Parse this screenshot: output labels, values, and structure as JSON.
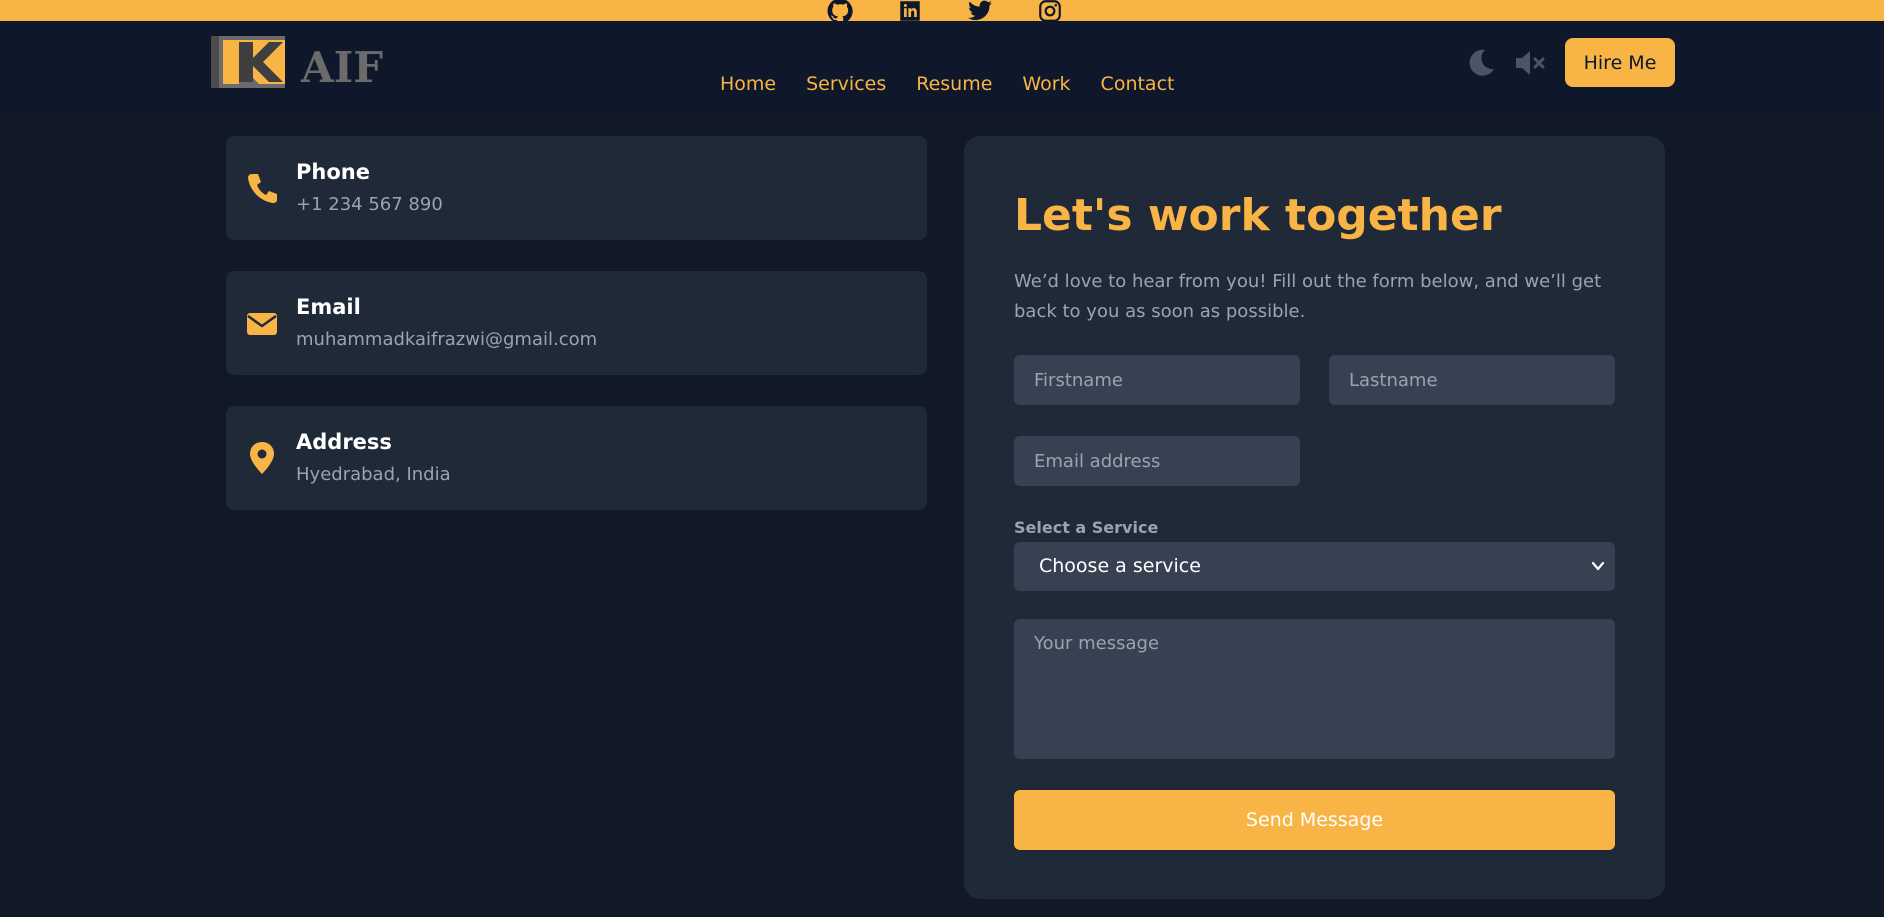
{
  "brand": {
    "logo_text": "AIF",
    "accent_color": "#f8b445",
    "background_color": "#111827"
  },
  "social_links": [
    {
      "icon": "github-icon"
    },
    {
      "icon": "linkedin-icon"
    },
    {
      "icon": "twitter-icon"
    },
    {
      "icon": "instagram-icon"
    }
  ],
  "nav": {
    "items": [
      "Home",
      "Services",
      "Resume",
      "Work",
      "Contact"
    ],
    "theme_toggle_icon": "moon-icon",
    "sound_toggle_icon": "volume-mute-icon",
    "hire_label": "Hire Me"
  },
  "contact_info": [
    {
      "icon": "phone-icon",
      "title": "Phone",
      "value": "+1 234 567 890"
    },
    {
      "icon": "envelope-icon",
      "title": "Email",
      "value": "muhammadkaifrazwi@gmail.com"
    },
    {
      "icon": "map-pin-icon",
      "title": "Address",
      "value": "Hyedrabad, India"
    }
  ],
  "form": {
    "title": "Let's work together",
    "intro": "We’d love to hear from you! Fill out the form below, and we’ll get back to you as soon as possible.",
    "firstname_placeholder": "Firstname",
    "lastname_placeholder": "Lastname",
    "email_placeholder": "Email address",
    "service_label": "Select a Service",
    "service_selected": "Choose a service",
    "message_placeholder": "Your message",
    "submit_label": "Send Message"
  }
}
